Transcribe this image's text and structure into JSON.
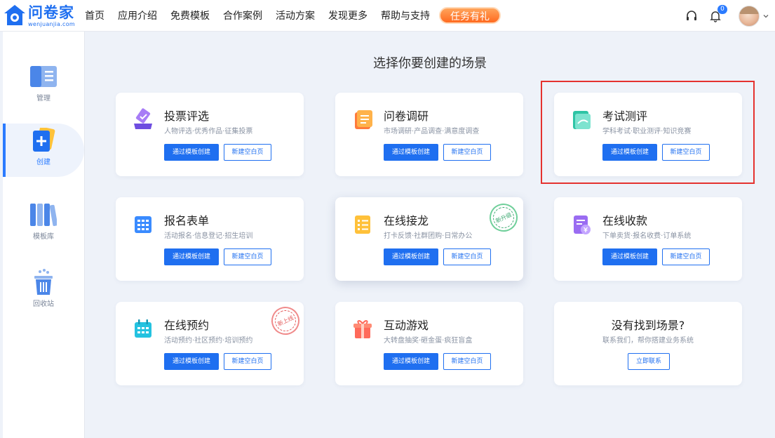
{
  "logo": {
    "name": "问卷家",
    "domain": "wenjuanjia.com"
  },
  "nav": {
    "items": [
      "首页",
      "应用介绍",
      "免费模板",
      "合作案例",
      "活动方案",
      "发现更多",
      "帮助与支持"
    ],
    "promo_label": "任务有礼"
  },
  "header": {
    "notification_count": "0"
  },
  "sidebar": {
    "items": [
      {
        "label": "管理",
        "icon": "panel-icon"
      },
      {
        "label": "创建",
        "icon": "create-plus-icon"
      },
      {
        "label": "模板库",
        "icon": "library-books-icon"
      },
      {
        "label": "回收站",
        "icon": "trash-bin-icon"
      }
    ],
    "active_index": 1
  },
  "main": {
    "title": "选择你要创建的场景",
    "template_button_label": "通过模板创建",
    "blank_button_label": "新建空白页",
    "cards": [
      {
        "title": "投票评选",
        "subtitle": "人物评选·优秀作品·征集投票",
        "icon": "vote-icon"
      },
      {
        "title": "问卷调研",
        "subtitle": "市场调研·产品调查·满意度调查",
        "icon": "survey-icon"
      },
      {
        "title": "考试测评",
        "subtitle": "学科考试·职业测评·知识竞赛",
        "icon": "exam-icon"
      },
      {
        "title": "报名表单",
        "subtitle": "活动报名·信息登记·招生培训",
        "icon": "signup-form-icon"
      },
      {
        "title": "在线接龙",
        "subtitle": "打卡反馈·社群团购·日常办公",
        "icon": "relay-list-icon",
        "stamp": "新升级"
      },
      {
        "title": "在线收款",
        "subtitle": "下单卖货·报名收费·订单系统",
        "icon": "payment-icon"
      },
      {
        "title": "在线预约",
        "subtitle": "活动预约·社区预约·培训预约",
        "icon": "calendar-icon",
        "stamp": "新上线"
      },
      {
        "title": "互动游戏",
        "subtitle": "大转盘抽奖·砸金蛋·疯狂盲盒",
        "icon": "gift-box-icon"
      }
    ],
    "contact_card": {
      "title": "没有找到场景?",
      "subtitle": "联系我们，帮你搭建业务系统",
      "button_label": "立即联系"
    }
  },
  "colors": {
    "accent": "#1f6ff0",
    "highlight": "#e5322f",
    "promo": "#ff7a2b"
  }
}
